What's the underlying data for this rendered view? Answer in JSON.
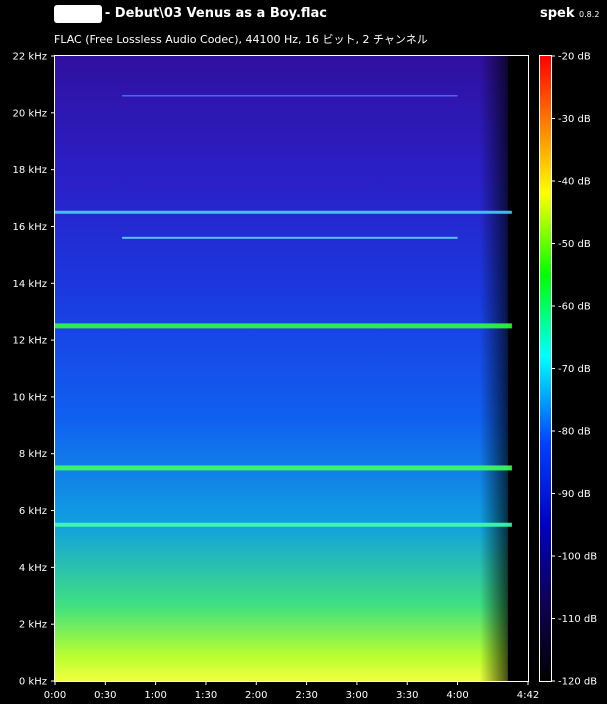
{
  "header": {
    "file_title": "Bjork - Debut\\03 Venus as a Boy.flac",
    "stream_info": "FLAC (Free Lossless Audio Codec), 44100 Hz, 16 ビット, 2 チャンネル",
    "app_name": "spek",
    "app_version": "0.8.2"
  },
  "chart_data": {
    "type": "heatmap",
    "x": {
      "ticks": [
        "0:00",
        "0:30",
        "1:00",
        "1:30",
        "2:00",
        "2:30",
        "3:00",
        "3:30",
        "4:00",
        "4:42"
      ],
      "tick_seconds": [
        0,
        30,
        60,
        90,
        120,
        150,
        180,
        210,
        240,
        282
      ],
      "range_seconds": [
        0,
        282
      ]
    },
    "y": {
      "ticks": [
        "0 kHz",
        "2 kHz",
        "4 kHz",
        "6 kHz",
        "8 kHz",
        "10 kHz",
        "12 kHz",
        "14 kHz",
        "16 kHz",
        "18 kHz",
        "20 kHz",
        "22 kHz"
      ],
      "tick_khz": [
        0,
        2,
        4,
        6,
        8,
        10,
        12,
        14,
        16,
        18,
        20,
        22
      ],
      "range_khz": [
        0,
        22
      ]
    },
    "colorbar": {
      "ticks": [
        "-20 dB",
        "-30 dB",
        "-40 dB",
        "-50 dB",
        "-60 dB",
        "-70 dB",
        "-80 dB",
        "-90 dB",
        "-100 dB",
        "-110 dB",
        "-120 dB"
      ],
      "tick_db": [
        -20,
        -30,
        -40,
        -50,
        -60,
        -70,
        -80,
        -90,
        -100,
        -110,
        -120
      ],
      "range_db": [
        -120,
        -20
      ],
      "colors": [
        "#ff0000",
        "#ff8000",
        "#ffff00",
        "#00ff00",
        "#00ffff",
        "#0040ff",
        "#0000c0",
        "#100050",
        "#000000"
      ]
    },
    "prominent_tones_khz": [
      12.5,
      7.5,
      5.5,
      16.5,
      15.6,
      20.6
    ],
    "signal_end_seconds": 270
  }
}
